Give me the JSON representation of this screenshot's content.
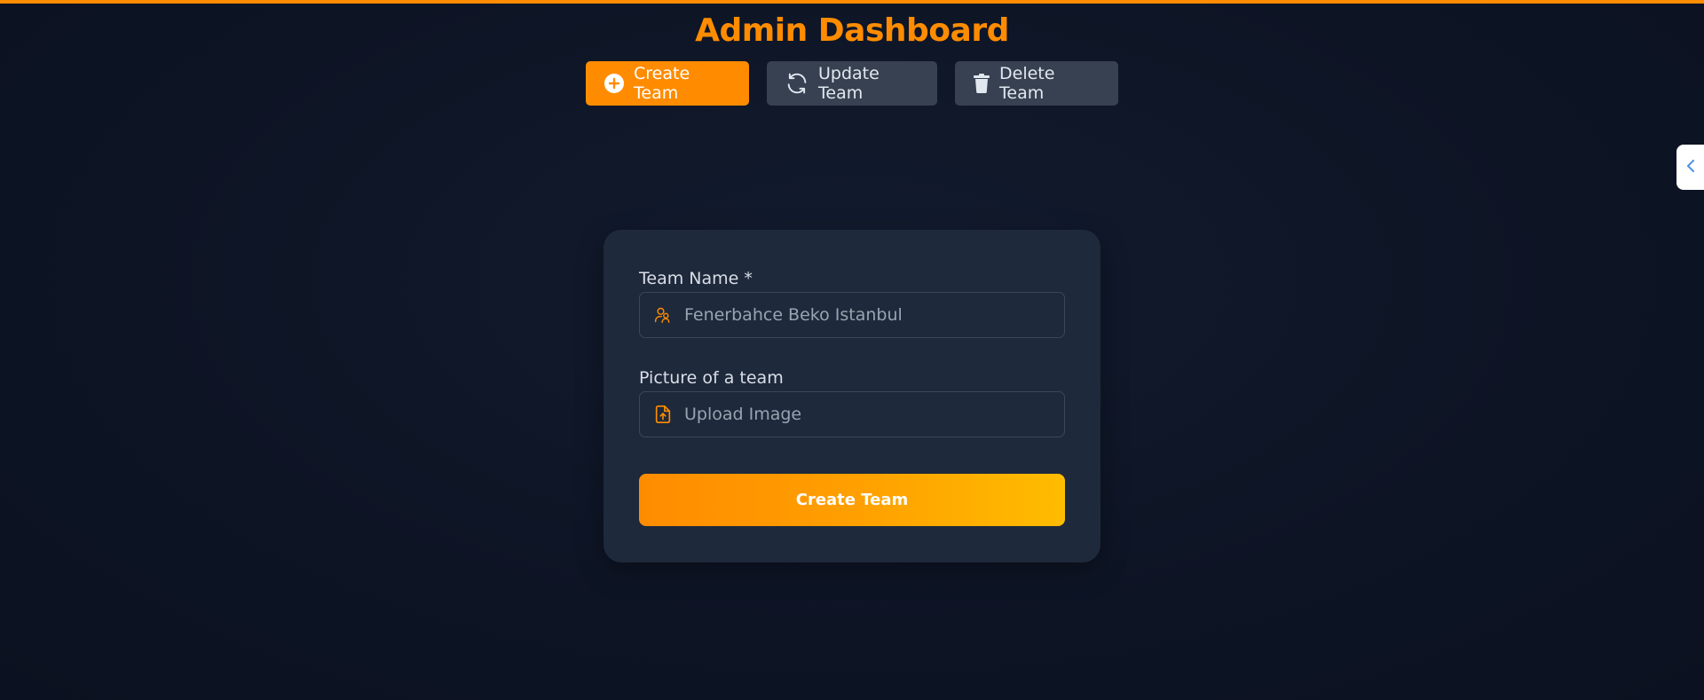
{
  "page": {
    "title": "Admin Dashboard"
  },
  "tabs": [
    {
      "label": "Create Team",
      "icon": "plus-circle-icon",
      "active": true
    },
    {
      "label": "Update Team",
      "icon": "refresh-icon",
      "active": false
    },
    {
      "label": "Delete Team",
      "icon": "trash-icon",
      "active": false
    }
  ],
  "side_toggle": {
    "icon": "chevron-left-icon"
  },
  "form": {
    "team_name_label": "Team Name *",
    "team_name_value": "Fenerbahce Beko Istanbul",
    "team_name_icon": "users-icon",
    "picture_label": "Picture of a team",
    "upload_placeholder": "Upload Image",
    "upload_icon": "file-upload-icon",
    "submit_label": "Create Team"
  },
  "colors": {
    "accent": "#ff8c00",
    "accent_gradient_end": "#ffbc00",
    "background": "#0d1424",
    "card": "#1e293b",
    "tab_inactive": "#374151",
    "toggle_chevron": "#4a90e2"
  }
}
